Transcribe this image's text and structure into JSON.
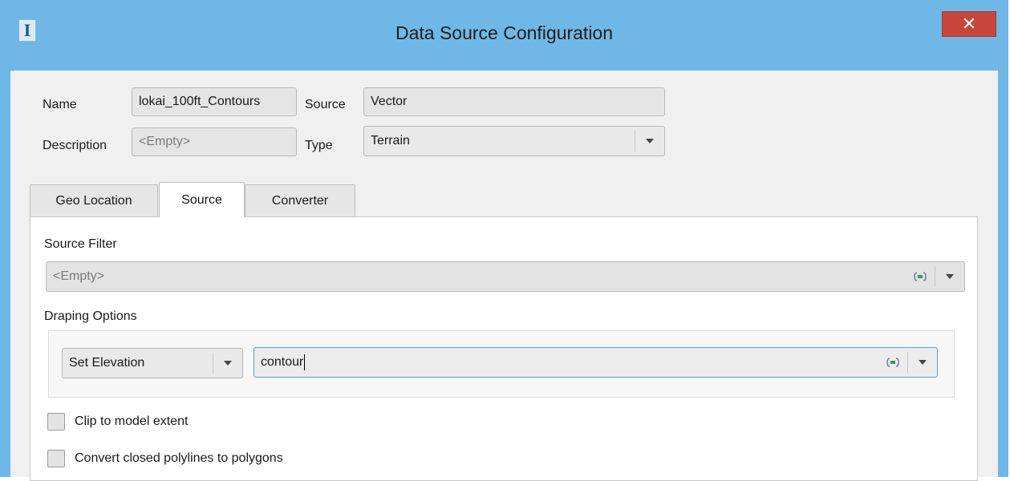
{
  "window": {
    "title": "Data Source Configuration",
    "app_icon_glyph": "I",
    "close_glyph": "✕"
  },
  "header": {
    "name_label": "Name",
    "name_value": "lokai_100ft_Contours",
    "source_label": "Source",
    "source_value": "Vector",
    "description_label": "Description",
    "description_placeholder": "<Empty>",
    "type_label": "Type",
    "type_value": "Terrain"
  },
  "tabs": [
    {
      "label": "Geo Location",
      "active": false
    },
    {
      "label": "Source",
      "active": true
    },
    {
      "label": "Converter",
      "active": false
    }
  ],
  "source_tab": {
    "source_filter_label": "Source Filter",
    "source_filter_placeholder": "<Empty>",
    "draping_options_label": "Draping Options",
    "draping_mode_value": "Set Elevation",
    "draping_attribute_value": "contour",
    "clip_label": "Clip to model extent",
    "clip_checked": false,
    "convert_label": "Convert closed polylines to polygons",
    "convert_checked": false
  },
  "icons": {
    "attribute_icon": "attribute-expression-icon",
    "dropdown": "chevron-down-icon"
  },
  "colors": {
    "titlebar": "#6fb7e6",
    "close_button": "#c7463b",
    "dialog_bg": "#f0f0f0",
    "focus_border": "#5a9fd4"
  }
}
